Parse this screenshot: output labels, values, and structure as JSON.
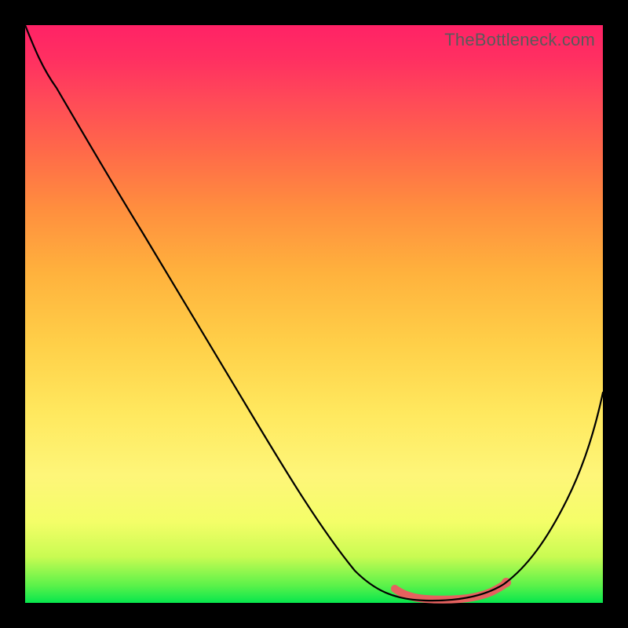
{
  "watermark": "TheBottleneck.com",
  "colors": {
    "gradient_top": "#ff2266",
    "gradient_bottom": "#07e64d",
    "line": "#000000",
    "highlight": "#e5615f",
    "frame_bg": "#000000"
  },
  "chart_data": {
    "type": "line",
    "title": "",
    "xlabel": "",
    "ylabel": "",
    "xlim": [
      0,
      100
    ],
    "ylim": [
      0,
      100
    ],
    "x": [
      0,
      4,
      8,
      12,
      16,
      20,
      24,
      28,
      32,
      36,
      40,
      44,
      48,
      52,
      56,
      60,
      64,
      68,
      72,
      76,
      80,
      84,
      88,
      92,
      96,
      100
    ],
    "values": [
      100,
      97,
      92,
      86,
      80,
      74,
      67,
      61,
      54,
      48,
      41,
      35,
      28,
      22,
      15,
      8,
      3,
      1,
      0.5,
      0.5,
      1,
      4,
      10,
      18,
      27,
      37
    ],
    "series": [
      {
        "name": "bottleneck-curve",
        "x": [
          0,
          4,
          8,
          12,
          16,
          20,
          24,
          28,
          32,
          36,
          40,
          44,
          48,
          52,
          56,
          60,
          64,
          68,
          72,
          76,
          80,
          84,
          88,
          92,
          96,
          100
        ],
        "y": [
          100,
          97,
          92,
          86,
          80,
          74,
          67,
          61,
          54,
          48,
          41,
          35,
          28,
          22,
          15,
          8,
          3,
          1,
          0.5,
          0.5,
          1,
          4,
          10,
          18,
          27,
          37
        ]
      }
    ],
    "highlight_range_x": [
      64,
      82
    ],
    "annotations": []
  }
}
